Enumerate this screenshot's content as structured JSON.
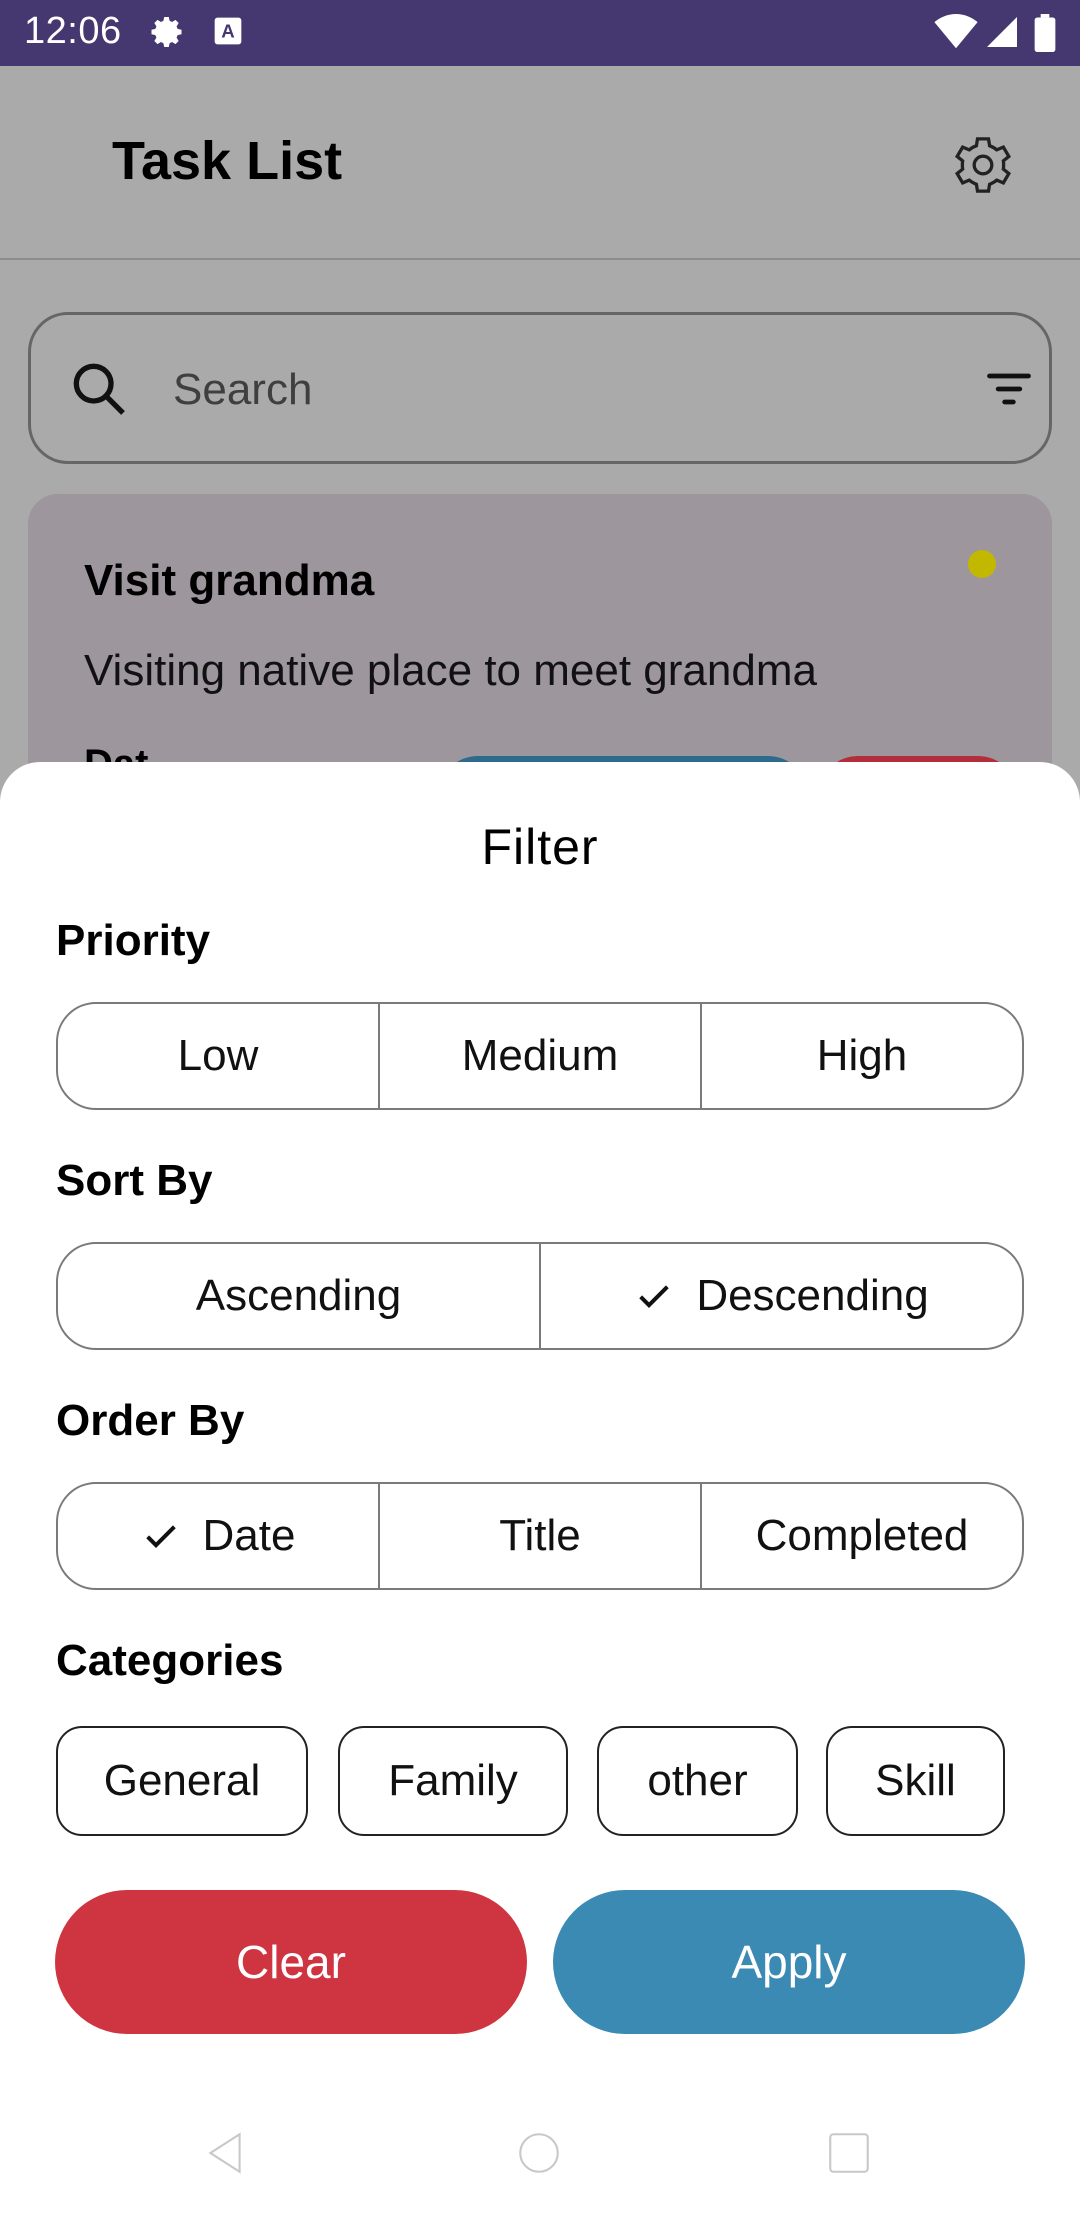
{
  "status_bar": {
    "time": "12:06",
    "icons": [
      "settings-gear-icon",
      "a11y-text-icon",
      "wifi-icon",
      "signal-icon",
      "battery-icon"
    ],
    "background_color": "#45376f"
  },
  "app_bar": {
    "title": "Task List",
    "settings_icon": "settings-icon"
  },
  "search": {
    "placeholder": "Search",
    "search_icon": "search-icon",
    "filter_icon": "filter-icon"
  },
  "task_card": {
    "title": "Visit grandma",
    "description": "Visiting native place to meet grandma",
    "date_label": "Dat",
    "priority_dot_color": "#c2b800"
  },
  "filter_sheet": {
    "title": "Filter",
    "priority": {
      "label": "Priority",
      "options": [
        "Low",
        "Medium",
        "High"
      ]
    },
    "sort_by": {
      "label": "Sort By",
      "options": [
        "Ascending",
        "Descending"
      ],
      "selected": "Descending"
    },
    "order_by": {
      "label": "Order By",
      "options": [
        "Date",
        "Title",
        "Completed"
      ],
      "selected": "Date"
    },
    "categories": {
      "label": "Categories",
      "options": [
        "General",
        "Family",
        "other",
        "Skill"
      ]
    },
    "buttons": {
      "clear": "Clear",
      "apply": "Apply"
    },
    "colors": {
      "clear": "#cf3541",
      "apply": "#3b8ab3"
    }
  },
  "nav_bar": {
    "icons": [
      "back-icon",
      "home-icon",
      "recents-icon"
    ]
  }
}
